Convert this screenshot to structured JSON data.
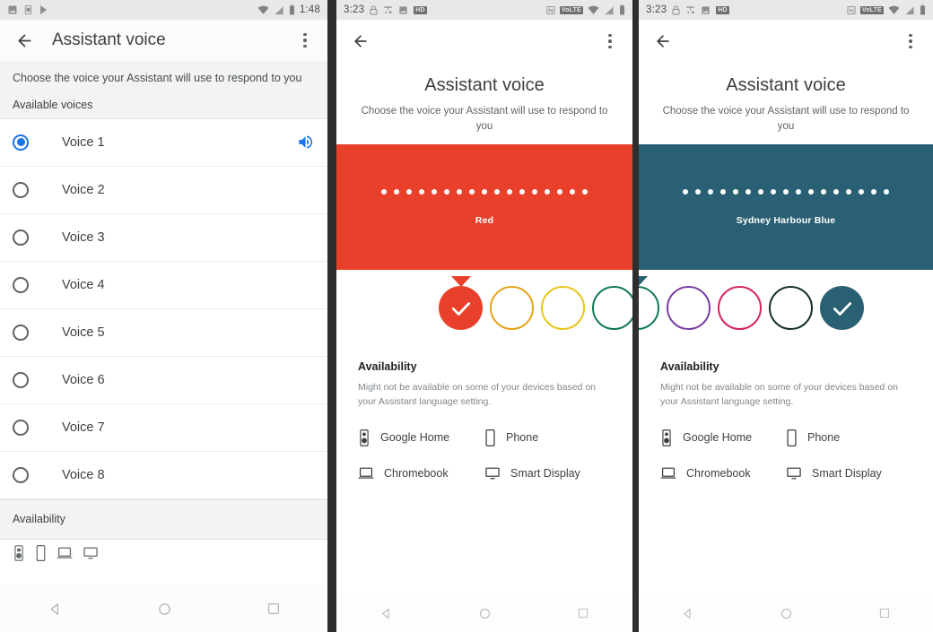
{
  "panels": [
    {
      "id": "voice-list",
      "statusbar": {
        "time": "1:48",
        "left_icons": [
          "image-icon",
          "sim-card-icon",
          "play-store-icon"
        ],
        "right_icons": [
          "wifi-icon",
          "signal-icon",
          "battery-icon"
        ]
      },
      "actionbar": {
        "title": "Assistant voice",
        "back": "back-arrow",
        "menu": "overflow-menu"
      },
      "subtitle": "Choose the voice your Assistant will use to respond to you",
      "section_label": "Available voices",
      "voices": [
        {
          "label": "Voice 1",
          "selected": true,
          "has_speaker": true
        },
        {
          "label": "Voice 2",
          "selected": false,
          "has_speaker": false
        },
        {
          "label": "Voice 3",
          "selected": false,
          "has_speaker": false
        },
        {
          "label": "Voice 4",
          "selected": false,
          "has_speaker": false
        },
        {
          "label": "Voice 5",
          "selected": false,
          "has_speaker": false
        },
        {
          "label": "Voice 6",
          "selected": false,
          "has_speaker": false
        },
        {
          "label": "Voice 7",
          "selected": false,
          "has_speaker": false
        },
        {
          "label": "Voice 8",
          "selected": false,
          "has_speaker": false
        }
      ],
      "availability_label": "Availability",
      "navbar": [
        "back-triangle",
        "home-circle",
        "recents-square"
      ]
    },
    {
      "id": "color-red",
      "statusbar": {
        "time": "3:23",
        "left_icons": [
          "lock-icon",
          "vpn-icon",
          "image-icon",
          "hd-badge"
        ],
        "right_icons": [
          "nfc-icon",
          "volte-badge",
          "wifi-icon",
          "signal-icon",
          "battery-icon"
        ]
      },
      "actionbar": {
        "back": "back-arrow",
        "menu": "overflow-menu"
      },
      "title": "Assistant voice",
      "subtitle": "Choose the voice your Assistant will use to respond to you",
      "hero": {
        "color_name": "Red",
        "color_hex": "#E8402A",
        "dot_count": 17
      },
      "swatches": [
        {
          "name": "Red",
          "hex": "#E8402A",
          "selected": true
        },
        {
          "name": "Amber",
          "hex": "#E8A317",
          "selected": false
        },
        {
          "name": "Yellow",
          "hex": "#E8C51C",
          "selected": false
        },
        {
          "name": "Green",
          "hex": "#12795C",
          "selected": false
        },
        {
          "name": "Purple",
          "hex": "#7B3FA0",
          "selected": false
        },
        {
          "name": "Pink",
          "hex": "#D4245F",
          "selected": false
        },
        {
          "name": "Dark Green",
          "hex": "#14301F",
          "selected": false
        },
        {
          "name": "Sydney Harbour Blue",
          "hex": "#2A6073",
          "selected": false
        }
      ],
      "availability": {
        "heading": "Availability",
        "description": "Might not be available on some of your devices based on your Assistant language setting.",
        "devices": [
          {
            "label": "Google Home",
            "icon": "speaker-icon"
          },
          {
            "label": "Phone",
            "icon": "phone-icon"
          },
          {
            "label": "Chromebook",
            "icon": "laptop-icon"
          },
          {
            "label": "Smart Display",
            "icon": "display-icon"
          }
        ]
      },
      "navbar": [
        "back-triangle",
        "home-circle",
        "recents-square"
      ]
    },
    {
      "id": "color-sydney-harbour-blue",
      "statusbar": {
        "time": "3:23",
        "left_icons": [
          "lock-icon",
          "vpn-icon",
          "image-icon",
          "hd-badge"
        ],
        "right_icons": [
          "nfc-icon",
          "volte-badge",
          "wifi-icon",
          "signal-icon",
          "battery-icon"
        ]
      },
      "actionbar": {
        "back": "back-arrow",
        "menu": "overflow-menu"
      },
      "title": "Assistant voice",
      "subtitle": "Choose the voice your Assistant will use to respond to you",
      "hero": {
        "color_name": "Sydney Harbour Blue",
        "color_hex": "#2A6073",
        "dot_count": 17
      },
      "swatches": [
        {
          "name": "Green",
          "hex": "#12795C",
          "selected": false
        },
        {
          "name": "Purple",
          "hex": "#7B3FA0",
          "selected": false
        },
        {
          "name": "Pink",
          "hex": "#D4245F",
          "selected": false
        },
        {
          "name": "Dark Green",
          "hex": "#14301F",
          "selected": false
        },
        {
          "name": "Sydney Harbour Blue",
          "hex": "#2A6073",
          "selected": true
        }
      ],
      "availability": {
        "heading": "Availability",
        "description": "Might not be available on some of your devices based on your Assistant language setting.",
        "devices": [
          {
            "label": "Google Home",
            "icon": "speaker-icon"
          },
          {
            "label": "Phone",
            "icon": "phone-icon"
          },
          {
            "label": "Chromebook",
            "icon": "laptop-icon"
          },
          {
            "label": "Smart Display",
            "icon": "display-icon"
          }
        ]
      },
      "navbar": [
        "back-triangle",
        "home-circle",
        "recents-square"
      ]
    }
  ],
  "colors": {
    "accent_blue": "#1a73e8",
    "red": "#E8402A",
    "sydney_harbour_blue": "#2A6073",
    "panel_gap": "#2e2e2e"
  }
}
